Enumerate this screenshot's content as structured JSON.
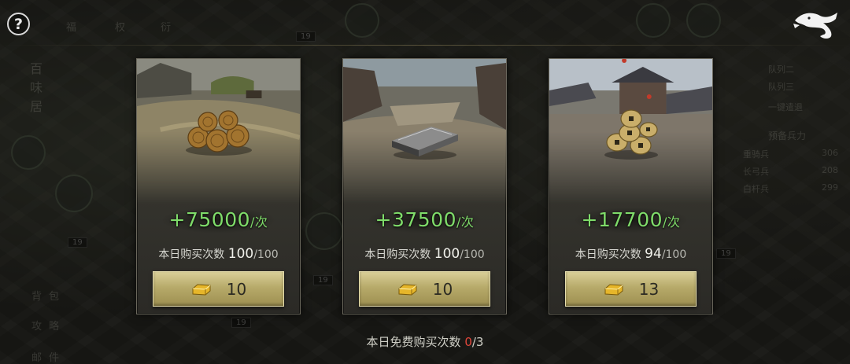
{
  "header": {
    "help_icon": "question-icon",
    "close_icon": "dragon-close-icon"
  },
  "background": {
    "labels": [
      "福",
      "权",
      "衍",
      "百",
      "味",
      "居",
      "背",
      "包",
      "攻",
      "略",
      "邮",
      "件",
      "队列二",
      "队列三",
      "一键遣退",
      "预备兵力",
      "重骑兵",
      "长弓兵",
      "白杆兵"
    ],
    "values": [
      "306",
      "208",
      "299"
    ],
    "badges": [
      "19",
      "19",
      "19",
      "19",
      "19"
    ]
  },
  "cards": [
    {
      "item_icon": "hay-bales-icon",
      "gain_value": "+75000",
      "gain_unit": "/次",
      "quota_label": "本日购买次数",
      "quota_current": "100",
      "quota_max": "/100",
      "price": "10",
      "currency_icon": "gold-ingot-icon"
    },
    {
      "item_icon": "iron-ingot-icon",
      "gain_value": "+37500",
      "gain_unit": "/次",
      "quota_label": "本日购买次数",
      "quota_current": "100",
      "quota_max": "/100",
      "price": "10",
      "currency_icon": "gold-ingot-icon"
    },
    {
      "item_icon": "copper-coins-icon",
      "gain_value": "+17700",
      "gain_unit": "/次",
      "quota_label": "本日购买次数",
      "quota_current": "94",
      "quota_max": "/100",
      "price": "13",
      "currency_icon": "gold-ingot-icon"
    }
  ],
  "footer": {
    "free_label": "本日免费购买次数",
    "free_used": "0",
    "free_total": "/3"
  },
  "colors": {
    "gain_green": "#7fdc6a",
    "used_red": "#e0463a",
    "button_gold": "#b7aa6a"
  }
}
